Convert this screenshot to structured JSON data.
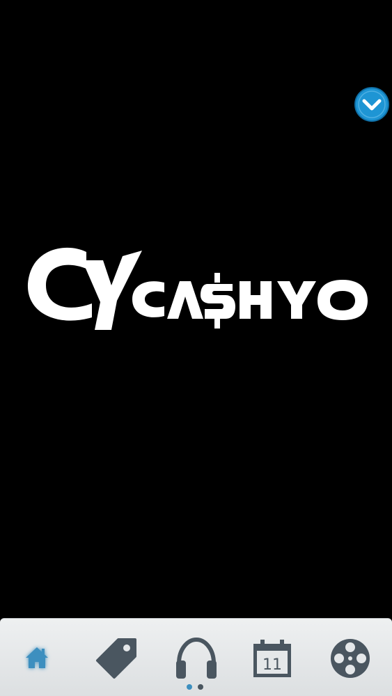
{
  "logo": {
    "text": "CYCASHYO",
    "color": "#ffffff"
  },
  "expand_button": {
    "icon": "chevron-down-icon",
    "color": "#1e95d4"
  },
  "tab_bar": {
    "items": [
      {
        "id": "home",
        "icon": "home-icon",
        "active": true
      },
      {
        "id": "tag",
        "icon": "tag-icon",
        "active": false
      },
      {
        "id": "music",
        "icon": "headphones-icon",
        "active": false
      },
      {
        "id": "calendar",
        "icon": "calendar-icon",
        "active": false,
        "day": "11"
      },
      {
        "id": "media",
        "icon": "film-reel-icon",
        "active": false
      }
    ],
    "active_color": "#3d8fbf",
    "inactive_color": "#4a5660",
    "pagination": {
      "pages": 2,
      "current": 1
    }
  }
}
